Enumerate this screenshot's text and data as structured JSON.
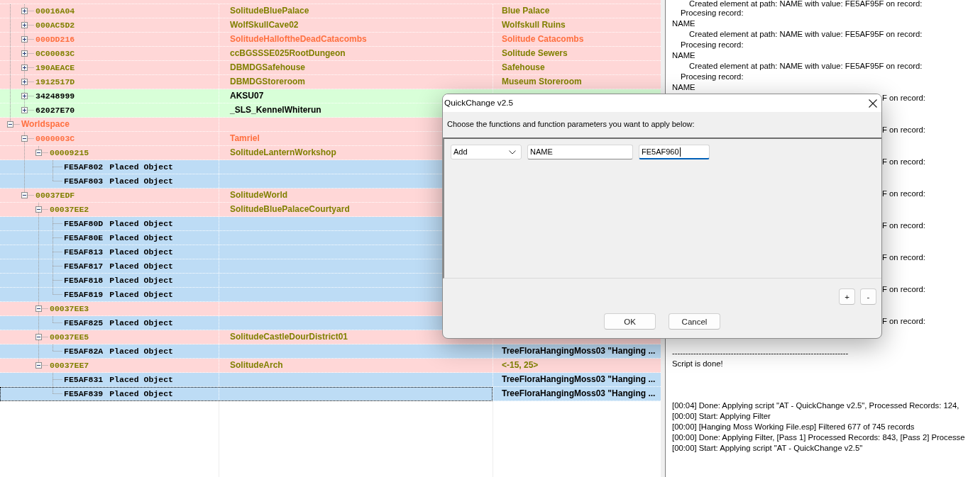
{
  "tree": {
    "nodes": [
      {
        "children": [
          {
            "kind": "record",
            "form_id": "00016A04",
            "editor_id": "SolitudeBluePalace",
            "name": "Blue Palace",
            "expanded": false,
            "selected": false,
            "color": "#ffd7d7",
            "font": {
              "color": "#808000"
            }
          },
          {
            "kind": "record",
            "form_id": "000AC5D2",
            "editor_id": "WolfSkullCave02",
            "name": "Wolfskull Ruins",
            "expanded": false,
            "selected": false,
            "color": "#ffd7d7",
            "font": {
              "color": "#808000"
            }
          },
          {
            "kind": "record",
            "form_id": "000DD216",
            "editor_id": "SolitudeHalloftheDeadCatacombs",
            "name": "Solitude Catacombs",
            "expanded": false,
            "selected": false,
            "color": "#ffd7d7",
            "font": {
              "color": "#ff7040"
            }
          },
          {
            "kind": "record",
            "form_id": "0C00083C",
            "editor_id": "ccBGSSSE025RootDungeon",
            "name": "Solitude Sewers",
            "expanded": false,
            "selected": false,
            "color": "#ffd7d7",
            "font": {
              "color": "#808000"
            }
          },
          {
            "kind": "record",
            "form_id": "190AEACE",
            "editor_id": "DBMDGSafehouse",
            "name": "Safehouse",
            "expanded": false,
            "selected": false,
            "color": "#ffd7d7",
            "font": {
              "color": "#808000"
            }
          },
          {
            "kind": "record",
            "form_id": "1912517D",
            "editor_id": "DBMDGStoreroom",
            "name": "Museum Storeroom",
            "expanded": false,
            "selected": false,
            "color": "#ffd7d7",
            "font": {
              "color": "#808000"
            }
          },
          {
            "kind": "record",
            "form_id": "34248999",
            "editor_id": "AKSU07",
            "expanded": false,
            "selected": false,
            "color": "#d8ffd8",
            "font": {
              "color": "#000000"
            }
          },
          {
            "kind": "record",
            "form_id": "62027E70",
            "editor_id": "_SLS_KennelWhiterun",
            "expanded": false,
            "selected": false,
            "color": "#d8ffd8",
            "font": {
              "color": "#000000"
            }
          }
        ]
      },
      {
        "kind": "group",
        "label": "Worldspace",
        "expanded": true,
        "selected": false,
        "color": "#ffd7d7",
        "font": {
          "color": "#ff7040"
        },
        "children": [
          {
            "kind": "record",
            "form_id": "0000003C",
            "editor_id": "Tamriel",
            "expanded": true,
            "selected": false,
            "color": "#ffd7d7",
            "font": {
              "color": "#ff7040"
            },
            "children": [
              {
                "kind": "record",
                "form_id": "00009215",
                "editor_id": "SolitudeLanternWorkshop",
                "expanded": true,
                "selected": false,
                "color": "#ffd7d7",
                "font": {
                  "color": "#808000"
                },
                "children": [
                  {
                    "kind": "reference",
                    "form_id": "FE5AF802",
                    "label": "Placed Object",
                    "selected": false,
                    "color": "#bddcf5",
                    "font": {
                      "color": "#000000"
                    }
                  },
                  {
                    "kind": "reference",
                    "form_id": "FE5AF803",
                    "label": "Placed Object",
                    "selected": false,
                    "color": "#bddcf5",
                    "font": {
                      "color": "#000000"
                    }
                  }
                ]
              }
            ]
          },
          {
            "kind": "record",
            "form_id": "00037EDF",
            "editor_id": "SolitudeWorld",
            "expanded": true,
            "selected": false,
            "color": "#ffd7d7",
            "font": {
              "color": "#808000"
            },
            "children": [
              {
                "kind": "record",
                "form_id": "00037EE2",
                "editor_id": "SolitudeBluePalaceCourtyard",
                "expanded": true,
                "selected": false,
                "color": "#ffd7d7",
                "font": {
                  "color": "#808000"
                },
                "children": [
                  {
                    "kind": "reference",
                    "form_id": "FE5AF80D",
                    "label": "Placed Object",
                    "selected": false,
                    "color": "#bddcf5",
                    "font": {
                      "color": "#000000"
                    }
                  },
                  {
                    "kind": "reference",
                    "form_id": "FE5AF80E",
                    "label": "Placed Object",
                    "selected": false,
                    "color": "#bddcf5",
                    "font": {
                      "color": "#000000"
                    }
                  },
                  {
                    "kind": "reference",
                    "form_id": "FE5AF813",
                    "label": "Placed Object",
                    "selected": false,
                    "color": "#bddcf5",
                    "font": {
                      "color": "#000000"
                    }
                  },
                  {
                    "kind": "reference",
                    "form_id": "FE5AF817",
                    "label": "Placed Object",
                    "selected": false,
                    "color": "#bddcf5",
                    "font": {
                      "color": "#000000"
                    }
                  },
                  {
                    "kind": "reference",
                    "form_id": "FE5AF818",
                    "label": "Placed Object",
                    "selected": false,
                    "color": "#bddcf5",
                    "font": {
                      "color": "#000000"
                    }
                  },
                  {
                    "kind": "reference",
                    "form_id": "FE5AF819",
                    "label": "Placed Object",
                    "selected": false,
                    "color": "#bddcf5",
                    "font": {
                      "color": "#000000"
                    }
                  }
                ]
              },
              {
                "kind": "record",
                "form_id": "00037EE3",
                "expanded": true,
                "selected": false,
                "color": "#ffd7d7",
                "font": {
                  "color": "#808000"
                },
                "children": [
                  {
                    "kind": "reference",
                    "form_id": "FE5AF825",
                    "label": "Placed Object",
                    "selected": false,
                    "color": "#bddcf5",
                    "font": {
                      "color": "#000000"
                    }
                  }
                ]
              },
              {
                "kind": "record",
                "form_id": "00037EE5",
                "editor_id": "SolitudeCastleDourDistrict01",
                "expanded": true,
                "selected": false,
                "color": "#ffd7d7",
                "font": {
                  "color": "#808000"
                },
                "children": [
                  {
                    "kind": "reference",
                    "form_id": "FE5AF82A",
                    "label": "Placed Object",
                    "name": "TreeFloraHangingMoss03 \"Hanging ...",
                    "selected": false,
                    "color": "#bddcf5",
                    "font": {
                      "color": "#000000"
                    }
                  }
                ]
              },
              {
                "kind": "record",
                "form_id": "00037EE7",
                "editor_id": "SolitudeArch",
                "name": "<-15, 25>",
                "expanded": true,
                "selected": false,
                "color": "#ffd7d7",
                "font": {
                  "color": "#808000"
                },
                "children": [
                  {
                    "kind": "reference",
                    "form_id": "FE5AF831",
                    "label": "Placed Object",
                    "name": "TreeFloraHangingMoss03 \"Hanging ...",
                    "selected": false,
                    "color": "#bddcf5",
                    "font": {
                      "color": "#000000"
                    }
                  },
                  {
                    "kind": "reference",
                    "form_id": "FE5AF839",
                    "label": "Placed Object",
                    "name": "TreeFloraHangingMoss03 \"Hanging ...",
                    "selected": true,
                    "color": "#bddcf5",
                    "font": {
                      "color": "#000000"
                    }
                  }
                ]
              }
            ]
          }
        ]
      }
    ]
  },
  "log": {
    "script_output": [
      {
        "kind": "detail",
        "text": "Created element at path: NAME with value: FE5AF95F on record:"
      },
      {
        "kind": "step",
        "text": "Procesing record:"
      },
      {
        "kind": "record",
        "text": "NAME"
      },
      {
        "kind": "detail",
        "text": "Created element at path: NAME with value: FE5AF95F on record:"
      },
      {
        "kind": "step",
        "text": "Procesing record:"
      },
      {
        "kind": "record",
        "text": "NAME"
      },
      {
        "kind": "detail",
        "text": "Created element at path: NAME with value: FE5AF95F on record:"
      },
      {
        "kind": "step",
        "text": "Procesing record:"
      },
      {
        "kind": "record",
        "text": "NAME"
      },
      {
        "kind": "clipped",
        "text": "F on record:"
      },
      {
        "kind": "clipped",
        "text": "F on record:"
      },
      {
        "kind": "clipped",
        "text": "F on record:"
      },
      {
        "kind": "clipped",
        "text": "F on record:"
      },
      {
        "kind": "clipped",
        "text": "F on record:"
      },
      {
        "kind": "clipped",
        "text": "F on record:"
      },
      {
        "kind": "clipped",
        "text": "F on record:"
      },
      {
        "kind": "clipped",
        "text": "F on record:"
      },
      {
        "kind": "record",
        "text": "------------------------------------------------------------------"
      },
      {
        "kind": "record",
        "text": "Script is done!"
      }
    ],
    "messages": [
      "[00:04] Done: Applying script \"AT - QuickChange v2.5\", Processed Records: 124,",
      "[00:00] Start: Applying Filter",
      "[00:00] [Hanging Moss Working File.esp] Filtered 677 of 745 records",
      "[00:00] Done: Applying Filter, [Pass 1] Processed Records: 843, [Pass 2] Processe",
      "[00:00] Start: Applying script \"AT - QuickChange v2.5\""
    ]
  },
  "dialog": {
    "title": "QuickChange v2.5",
    "description": "Choose the functions and function parameters you want to apply below:",
    "fields": [
      {
        "kind": "dropdown",
        "value": "Add",
        "focused": false
      },
      {
        "kind": "text",
        "value": "NAME",
        "focused": false
      },
      {
        "kind": "text",
        "value": "FE5AF960",
        "focused": true
      }
    ],
    "row_buttons": [
      "+",
      "-"
    ],
    "buttons": [
      "OK",
      "Cancel"
    ]
  }
}
